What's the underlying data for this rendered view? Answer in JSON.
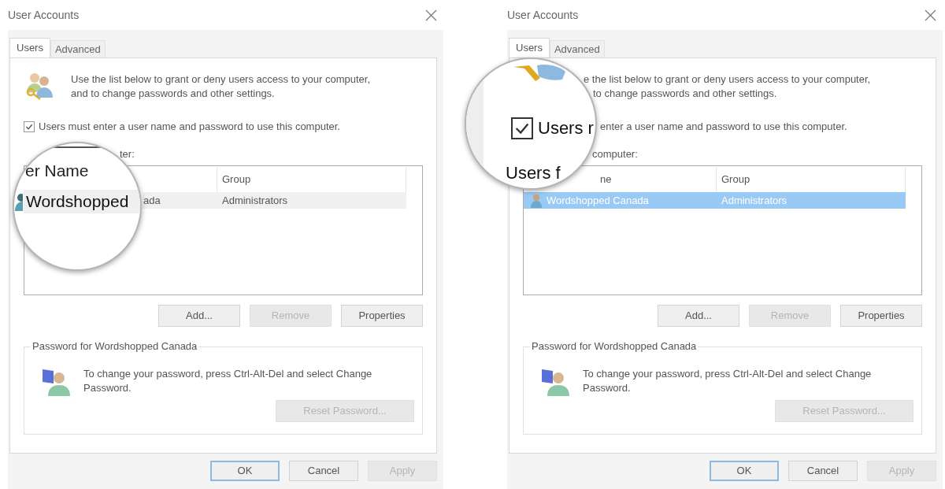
{
  "panels": [
    {
      "title": "User Accounts",
      "tabs": [
        {
          "label": "Users",
          "selected": true
        },
        {
          "label": "Advanced",
          "selected": false
        }
      ],
      "description_lines": [
        "Use the list below to grant or deny users access to your computer,",
        "and to change passwords and other settings."
      ],
      "checkbox": {
        "label": "Users must enter a user name and password to use this computer.",
        "checked": true
      },
      "users_label": "ter:",
      "list": {
        "focused": false,
        "group_header": "Group",
        "rows": [
          {
            "name": "ada",
            "group": "Administrators",
            "selected": true
          }
        ]
      },
      "list_buttons": [
        {
          "label": "Add...",
          "disabled": false
        },
        {
          "label": "Remove",
          "disabled": true
        },
        {
          "label": "Properties",
          "disabled": false
        }
      ],
      "password_group": {
        "legend": "Password for Wordshopped Canada",
        "text": "To change your password, press Ctrl-Alt-Del and select Change Password.",
        "button": {
          "label": "Reset Password...",
          "disabled": true
        }
      },
      "footer_buttons": [
        {
          "label": "OK",
          "default": true,
          "disabled": false
        },
        {
          "label": "Cancel",
          "default": false,
          "disabled": false
        },
        {
          "label": "Apply",
          "default": false,
          "disabled": true
        }
      ],
      "magnifier": {
        "items": [
          {
            "kind": "header",
            "text": "er Name"
          },
          {
            "kind": "row",
            "text": "Wordshopped",
            "selected": true
          }
        ]
      }
    },
    {
      "title": "User Accounts",
      "tabs": [
        {
          "label": "Users",
          "selected": true
        },
        {
          "label": "Advanced",
          "selected": false
        }
      ],
      "description_lines": [
        "e the list below to grant or deny users access to your computer,",
        "to change passwords and other settings."
      ],
      "checkbox_label": "enter a user name and password to use this computer.",
      "users_label": "computer:",
      "list": {
        "focused": true,
        "name_header": "ne",
        "group_header": "Group",
        "rows": [
          {
            "name": "Wordshopped Canada",
            "group": "Administrators",
            "selected": true
          }
        ]
      },
      "list_buttons": [
        {
          "label": "Add...",
          "disabled": false
        },
        {
          "label": "Remove",
          "disabled": true
        },
        {
          "label": "Properties",
          "disabled": false
        }
      ],
      "password_group": {
        "legend": "Password for Wordshopped Canada",
        "text": "To change your password, press Ctrl-Alt-Del and select Change Password.",
        "button": {
          "label": "Reset Password...",
          "disabled": true
        }
      },
      "footer_buttons": [
        {
          "label": "OK",
          "default": true,
          "disabled": false
        },
        {
          "label": "Cancel",
          "default": false,
          "disabled": false
        },
        {
          "label": "Apply",
          "default": false,
          "disabled": true
        }
      ],
      "magnifier": {
        "items": [
          {
            "kind": "checkbox",
            "text": "Users r",
            "checked": true
          },
          {
            "kind": "heading",
            "text": "Users f"
          }
        ]
      }
    }
  ]
}
